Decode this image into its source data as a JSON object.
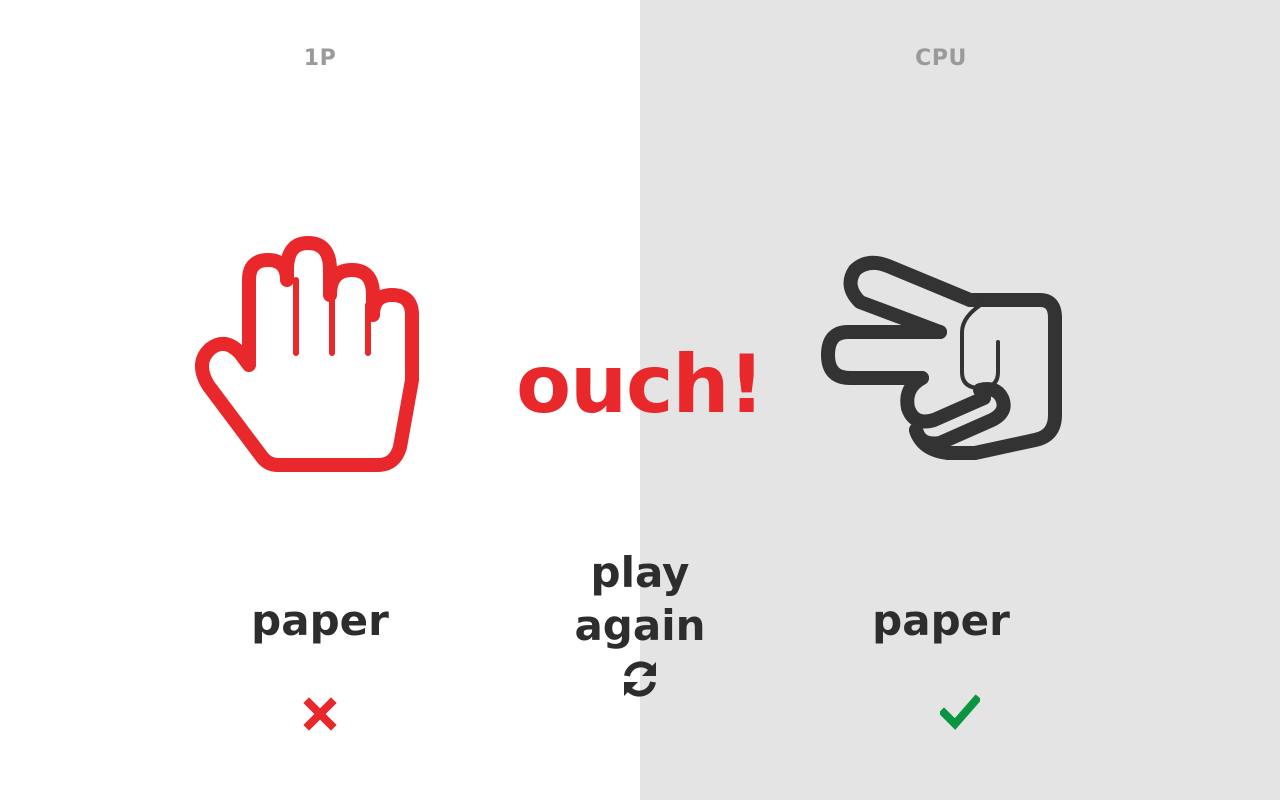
{
  "players": {
    "left": {
      "label": "1P",
      "choice": "paper",
      "hand_icon": "paper-hand-icon",
      "result_icon": "cross-icon",
      "result": "lose"
    },
    "right": {
      "label": "CPU",
      "choice": "paper",
      "hand_icon": "scissors-hand-icon",
      "result_icon": "check-icon",
      "result": "win"
    }
  },
  "message": "ouch!",
  "play_again": {
    "line1": "play",
    "line2": "again",
    "icon": "refresh-icon"
  },
  "colors": {
    "accent_red": "#e8282b",
    "text_dark": "#2d2d2d",
    "label_gray": "#9a9a9a",
    "win_green": "#0a9640",
    "right_panel_bg": "#e4e4e4",
    "left_panel_bg": "#ffffff",
    "cpu_hand": "#333333"
  }
}
